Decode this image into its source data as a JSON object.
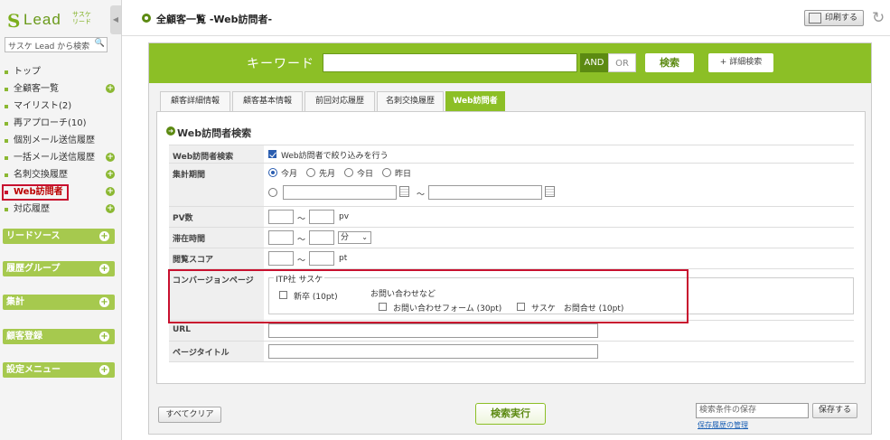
{
  "brand": {
    "mark": "S",
    "name": "Lead",
    "sub_line1": "サスケ",
    "sub_line2": "リード"
  },
  "sidebar": {
    "search_placeholder": "サスケ Lead から検索",
    "items": [
      {
        "label": "トップ",
        "plus": false
      },
      {
        "label": "全顧客一覧",
        "plus": true
      },
      {
        "label": "マイリスト(2)",
        "plus": false
      },
      {
        "label": "再アプローチ(10)",
        "plus": false
      },
      {
        "label": "個別メール送信履歴",
        "plus": false
      },
      {
        "label": "一括メール送信履歴",
        "plus": true
      },
      {
        "label": "名刺交換履歴",
        "plus": true
      },
      {
        "label": "Web訪問者",
        "plus": true,
        "active": true
      },
      {
        "label": "対応履歴",
        "plus": true
      }
    ],
    "groups": [
      "リードソース",
      "履歴グループ",
      "集計",
      "顧客登録",
      "設定メニュー"
    ]
  },
  "header": {
    "title": "全顧客一覧 -Web訪問者-",
    "print_label": "印刷する"
  },
  "keyword": {
    "label": "キーワード",
    "and": "AND",
    "or": "OR",
    "search": "検索",
    "advanced": "+ 詳細検索"
  },
  "tabs": [
    "顧客詳細情報",
    "顧客基本情報",
    "前回対応履歴",
    "名刺交換履歴",
    "Web訪問者"
  ],
  "section_title": "Web訪問者検索",
  "form": {
    "web_search": {
      "label": "Web訪問者検索",
      "checkbox_label": "Web訪問者で絞り込みを行う"
    },
    "period": {
      "label": "集計期間",
      "options": [
        "今月",
        "先月",
        "今日",
        "昨日"
      ],
      "tilde": "～"
    },
    "pv": {
      "label": "PV数",
      "tilde": "～",
      "unit": "pv"
    },
    "stay": {
      "label": "滞在時間",
      "tilde": "～",
      "unit": "分"
    },
    "score": {
      "label": "閲覧スコア",
      "tilde": "～",
      "unit": "pt"
    },
    "conversion": {
      "label": "コンバージョンページ",
      "group": "ITP社 サスケ",
      "item1": "新卒 (10pt)",
      "subgroup": "お問い合わせなど",
      "item2": "お問い合わせフォーム (30pt)",
      "item3": "サスケ　お問合せ (10pt)"
    },
    "url": {
      "label": "URL"
    },
    "page_title": {
      "label": "ページタイトル"
    }
  },
  "footer": {
    "clear": "すべてクリア",
    "execute": "検索実行",
    "save_placeholder": "検索条件の保存",
    "save": "保存する",
    "history_link": "保存履歴の管理"
  },
  "colors": {
    "accent": "#8cbf26",
    "accent_dark": "#5c8a12",
    "highlight": "#c8102e"
  }
}
